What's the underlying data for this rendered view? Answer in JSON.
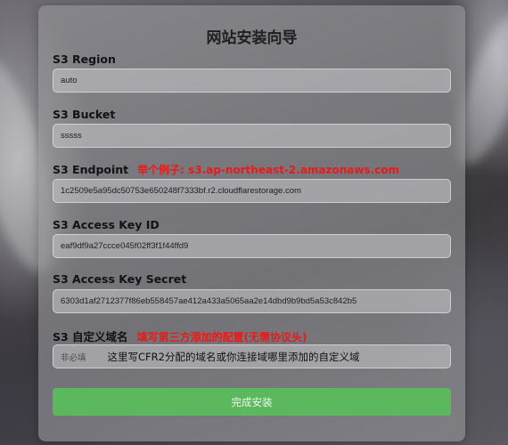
{
  "page": {
    "title": "网站安装向导"
  },
  "form": {
    "region": {
      "label": "S3 Region",
      "value": "auto"
    },
    "bucket": {
      "label": "S3 Bucket",
      "value": "sssss"
    },
    "endpoint": {
      "label": "S3 Endpoint",
      "hint": "举个例子: s3.ap-northeast-2.amazonaws.com",
      "value": "1c2509e5a95dc50753e650248f7333bf.r2.cloudflarestorage.com"
    },
    "access_key_id": {
      "label": "S3 Access Key ID",
      "value": "eaf9df9a27ccce045f02ff3f1f44ffd9"
    },
    "access_key_secret": {
      "label": "S3 Access Key Secret",
      "value": "6303d1af2712377f86eb558457ae412a433a5065aa2e14dbd9b9bd5a53c842b5"
    },
    "custom_domain": {
      "label": "S3 自定义域名",
      "hint": "填写第三方添加的配置(无需协议头)",
      "placeholder": "非必填",
      "annotation": "这里写CFR2分配的域名或你连接域哪里添加的自定义域"
    },
    "submit_label": "完成安装"
  },
  "colors": {
    "hint_red": "#e81a1a",
    "submit_green": "#5cb85c"
  }
}
